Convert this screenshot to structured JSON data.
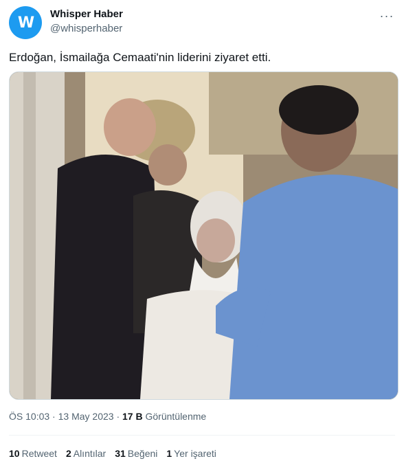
{
  "author": {
    "avatar_letter": "W",
    "avatar_color": "#1d9bf0",
    "name": "Whisper Haber",
    "handle": "@whisperhaber"
  },
  "more_icon": "more-dots-icon",
  "tweet": {
    "text": "Erdoğan, İsmailağa Cemaati'nin liderini ziyaret etti."
  },
  "meta": {
    "time": "ÖS 10:03",
    "sep1": " · ",
    "date": "13 May 2023",
    "sep2": " · ",
    "views_count": "17 B",
    "views_label": " Görüntülenme"
  },
  "stats": {
    "retweets_count": "10",
    "retweets_label": "Retweet",
    "quotes_count": "2",
    "quotes_label": "Alıntılar",
    "likes_count": "31",
    "likes_label": "Beğeni",
    "bookmarks_count": "1",
    "bookmarks_label": "Yer işareti"
  },
  "colors": {
    "accent": "#1d9bf0",
    "text": "#0f1419",
    "secondary": "#536471"
  }
}
